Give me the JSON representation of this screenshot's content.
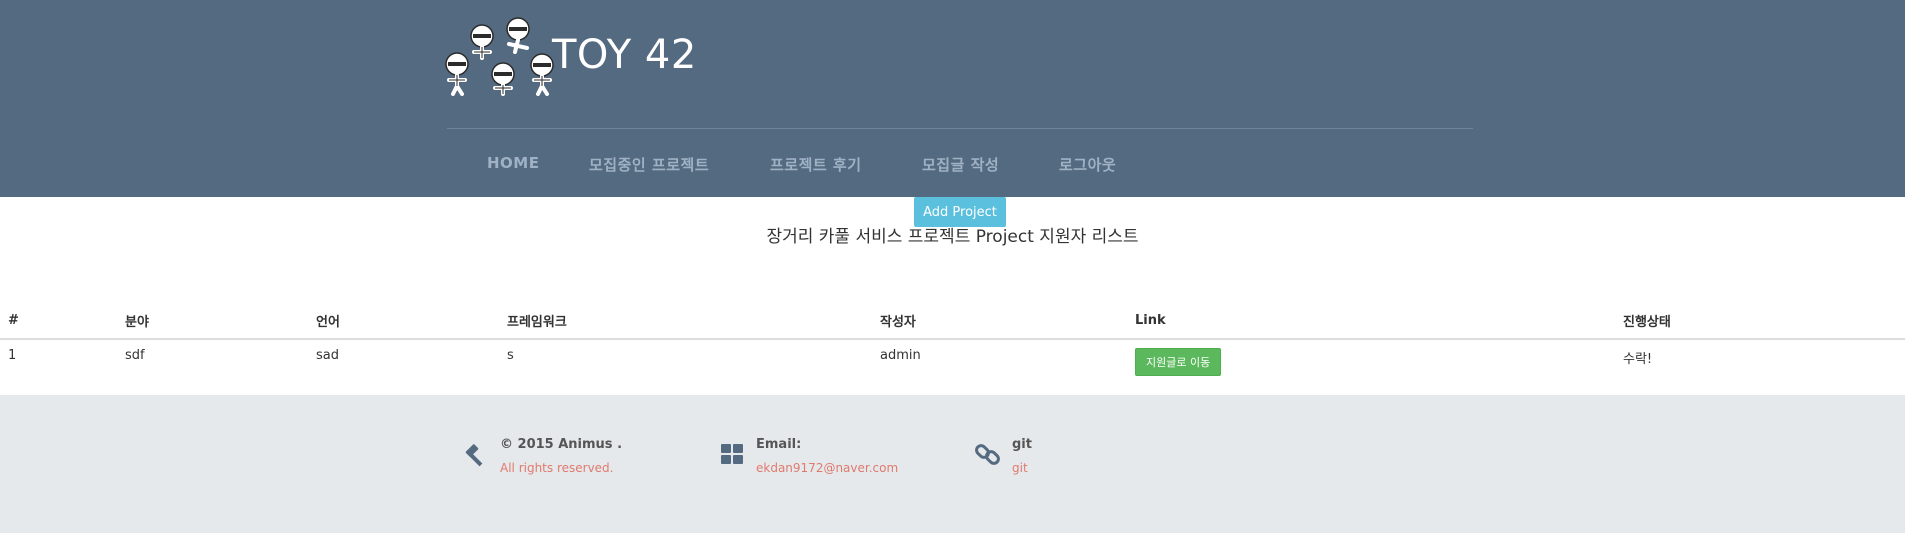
{
  "brand": {
    "title": "TOY 42",
    "logo_icon": "ninja-group-logo"
  },
  "nav": {
    "items": [
      {
        "label": "HOME"
      },
      {
        "label": "모집중인 프로젝트"
      },
      {
        "label": "프로젝트 후기"
      },
      {
        "label": "모집글 작성"
      },
      {
        "label": "로그아웃"
      }
    ]
  },
  "add_project_label": "Add Project",
  "page_title": "장거리 카풀 서비스 프로젝트 Project 지원자 리스트",
  "table": {
    "headers": [
      "#",
      "분야",
      "언어",
      "프레임워크",
      "작성자",
      "Link",
      "진행상태"
    ],
    "rows": [
      {
        "num": "1",
        "field": "sdf",
        "language": "sad",
        "framework": "s",
        "author": "admin",
        "link_label": "지원글로 이동",
        "status": "수락!"
      }
    ]
  },
  "footer": {
    "copyright": {
      "title": "© 2015 Animus .",
      "sub": "All rights reserved.",
      "icon": "gavel-icon"
    },
    "email": {
      "title": "Email:",
      "sub": "ekdan9172@naver.com",
      "icon": "grid-icon"
    },
    "git": {
      "title": "git",
      "sub": "git",
      "icon": "link-icon"
    }
  },
  "colors": {
    "header_bg": "#546a80",
    "nav_text": "#9fb1c4",
    "add_button": "#5bc0de",
    "apply_button": "#5cb85c",
    "footer_bg": "#e6e9ec",
    "footer_link": "#e07a6e"
  }
}
